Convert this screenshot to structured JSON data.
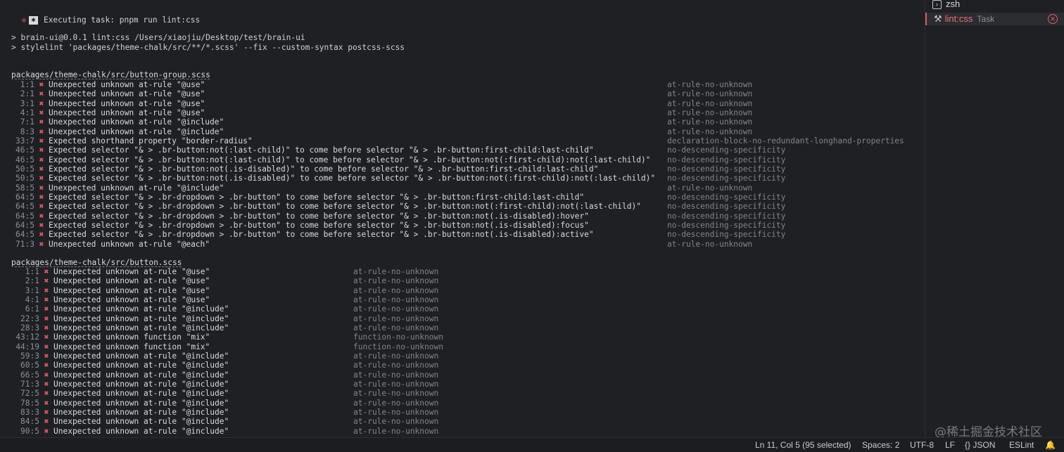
{
  "terminal": {
    "task_header": "Executing task: pnpm run lint:css",
    "cmd1": "> brain-ui@0.0.1 lint:css /Users/xiaojiu/Desktop/test/brain-ui",
    "cmd2": "> stylelint 'packages/theme-chalk/src/**/*.scss' --fix --custom-syntax postcss-scss",
    "files": [
      {
        "title": "packages/theme-chalk/src/button-group.scss",
        "entries": [
          {
            "loc": "1:1",
            "msg": "Unexpected unknown at-rule \"@use\"",
            "rule": "at-rule-no-unknown"
          },
          {
            "loc": "2:1",
            "msg": "Unexpected unknown at-rule \"@use\"",
            "rule": "at-rule-no-unknown"
          },
          {
            "loc": "3:1",
            "msg": "Unexpected unknown at-rule \"@use\"",
            "rule": "at-rule-no-unknown"
          },
          {
            "loc": "4:1",
            "msg": "Unexpected unknown at-rule \"@use\"",
            "rule": "at-rule-no-unknown"
          },
          {
            "loc": "7:1",
            "msg": "Unexpected unknown at-rule \"@include\"",
            "rule": "at-rule-no-unknown"
          },
          {
            "loc": "8:3",
            "msg": "Unexpected unknown at-rule \"@include\"",
            "rule": "at-rule-no-unknown"
          },
          {
            "loc": "33:7",
            "msg": "Expected shorthand property \"border-radius\"",
            "rule": "declaration-block-no-redundant-longhand-properties"
          },
          {
            "loc": "46:5",
            "msg": "Expected selector \"& > .br-button:not(:last-child)\" to come before selector \"& > .br-button:first-child:last-child\"",
            "rule": "no-descending-specificity"
          },
          {
            "loc": "46:5",
            "msg": "Expected selector \"& > .br-button:not(:last-child)\" to come before selector \"& > .br-button:not(:first-child):not(:last-child)\"",
            "rule": "no-descending-specificity"
          },
          {
            "loc": "50:5",
            "msg": "Expected selector \"& > .br-button:not(.is-disabled)\" to come before selector \"& > .br-button:first-child:last-child\"",
            "rule": "no-descending-specificity"
          },
          {
            "loc": "50:5",
            "msg": "Expected selector \"& > .br-button:not(.is-disabled)\" to come before selector \"& > .br-button:not(:first-child):not(:last-child)\"",
            "rule": "no-descending-specificity"
          },
          {
            "loc": "58:5",
            "msg": "Unexpected unknown at-rule \"@include\"",
            "rule": "at-rule-no-unknown"
          },
          {
            "loc": "64:5",
            "msg": "Expected selector \"& > .br-dropdown > .br-button\" to come before selector \"& > .br-button:first-child:last-child\"",
            "rule": "no-descending-specificity"
          },
          {
            "loc": "64:5",
            "msg": "Expected selector \"& > .br-dropdown > .br-button\" to come before selector \"& > .br-button:not(:first-child):not(:last-child)\"",
            "rule": "no-descending-specificity"
          },
          {
            "loc": "64:5",
            "msg": "Expected selector \"& > .br-dropdown > .br-button\" to come before selector \"& > .br-button:not(.is-disabled):hover\"",
            "rule": "no-descending-specificity"
          },
          {
            "loc": "64:5",
            "msg": "Expected selector \"& > .br-dropdown > .br-button\" to come before selector \"& > .br-button:not(.is-disabled):focus\"",
            "rule": "no-descending-specificity"
          },
          {
            "loc": "64:5",
            "msg": "Expected selector \"& > .br-dropdown > .br-button\" to come before selector \"& > .br-button:not(.is-disabled):active\"",
            "rule": "no-descending-specificity"
          },
          {
            "loc": "71:3",
            "msg": "Unexpected unknown at-rule \"@each\"",
            "rule": "at-rule-no-unknown"
          }
        ]
      },
      {
        "title": "packages/theme-chalk/src/button.scss",
        "entries": [
          {
            "loc": "1:1",
            "msg": "Unexpected unknown at-rule \"@use\"",
            "rule": "at-rule-no-unknown"
          },
          {
            "loc": "2:1",
            "msg": "Unexpected unknown at-rule \"@use\"",
            "rule": "at-rule-no-unknown"
          },
          {
            "loc": "3:1",
            "msg": "Unexpected unknown at-rule \"@use\"",
            "rule": "at-rule-no-unknown"
          },
          {
            "loc": "4:1",
            "msg": "Unexpected unknown at-rule \"@use\"",
            "rule": "at-rule-no-unknown"
          },
          {
            "loc": "6:1",
            "msg": "Unexpected unknown at-rule \"@include\"",
            "rule": "at-rule-no-unknown"
          },
          {
            "loc": "22:3",
            "msg": "Unexpected unknown at-rule \"@include\"",
            "rule": "at-rule-no-unknown"
          },
          {
            "loc": "28:3",
            "msg": "Unexpected unknown at-rule \"@include\"",
            "rule": "at-rule-no-unknown"
          },
          {
            "loc": "43:12",
            "msg": "Unexpected unknown function \"mix\"",
            "rule": "function-no-unknown"
          },
          {
            "loc": "44:19",
            "msg": "Unexpected unknown function \"mix\"",
            "rule": "function-no-unknown"
          },
          {
            "loc": "59:3",
            "msg": "Unexpected unknown at-rule \"@include\"",
            "rule": "at-rule-no-unknown"
          },
          {
            "loc": "60:5",
            "msg": "Unexpected unknown at-rule \"@include\"",
            "rule": "at-rule-no-unknown"
          },
          {
            "loc": "66:5",
            "msg": "Unexpected unknown at-rule \"@include\"",
            "rule": "at-rule-no-unknown"
          },
          {
            "loc": "71:3",
            "msg": "Unexpected unknown at-rule \"@include\"",
            "rule": "at-rule-no-unknown"
          },
          {
            "loc": "72:5",
            "msg": "Unexpected unknown at-rule \"@include\"",
            "rule": "at-rule-no-unknown"
          },
          {
            "loc": "78:5",
            "msg": "Unexpected unknown at-rule \"@include\"",
            "rule": "at-rule-no-unknown"
          },
          {
            "loc": "83:3",
            "msg": "Unexpected unknown at-rule \"@include\"",
            "rule": "at-rule-no-unknown"
          },
          {
            "loc": "84:5",
            "msg": "Unexpected unknown at-rule \"@include\"",
            "rule": "at-rule-no-unknown"
          },
          {
            "loc": "90:5",
            "msg": "Unexpected unknown at-rule \"@include\"",
            "rule": "at-rule-no-unknown"
          }
        ]
      }
    ]
  },
  "panel": {
    "zsh_label": "zsh",
    "task_label": "lint:css",
    "task_tag": "Task"
  },
  "statusbar": {
    "position": "Ln 11, Col 5 (95 selected)",
    "spaces": "Spaces: 2",
    "encoding": "UTF-8",
    "eol": "LF",
    "language": "{} JSON",
    "linter": "ESLint"
  },
  "watermark": "@稀土掘金技术社区",
  "colors": {
    "error": "#e05a67",
    "background": "#1f2023"
  }
}
